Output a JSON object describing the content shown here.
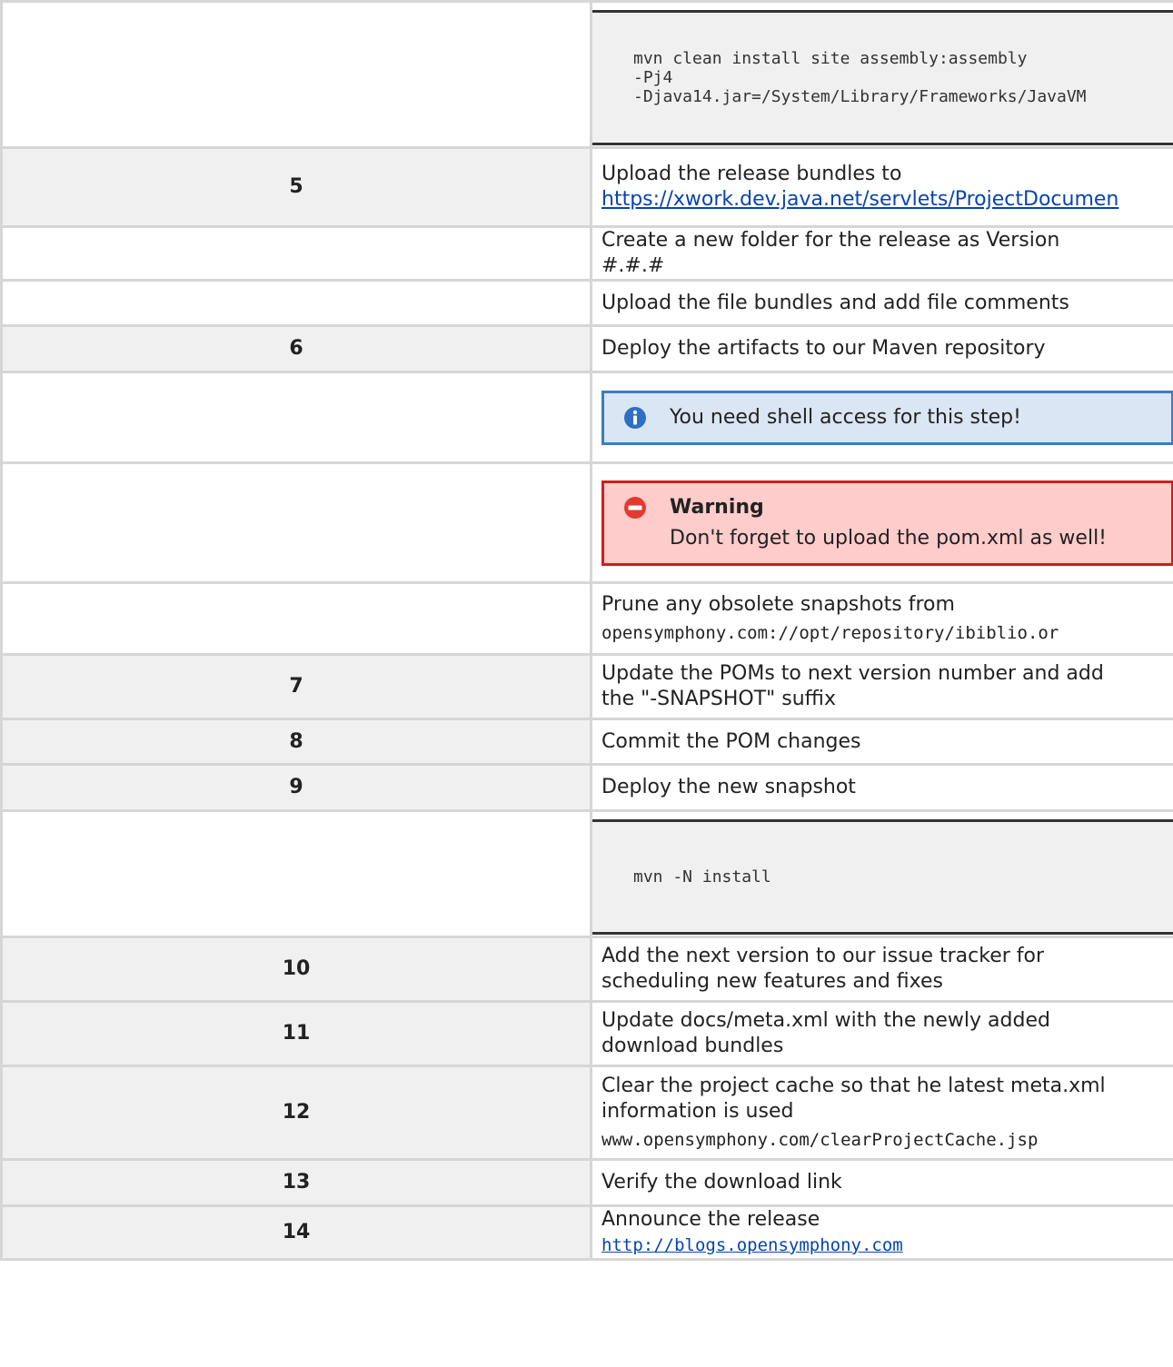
{
  "rows": [
    {
      "step": "",
      "type": "code",
      "code": [
        "mvn clean install site assembly:assembly",
        "-Pj4",
        "-Djava14.jar=/System/Library/Frameworks/JavaVM"
      ]
    },
    {
      "step": "5",
      "type": "text_link",
      "text": "Upload the release bundles to",
      "link": "https://xwork.dev.java.net/servlets/ProjectDocumen"
    },
    {
      "step": "",
      "type": "text",
      "lines": [
        "Create a new folder for the release as Version",
        "#.#.#"
      ]
    },
    {
      "step": "",
      "type": "text",
      "lines": [
        "Upload the file bundles and add file comments"
      ]
    },
    {
      "step": "6",
      "type": "text",
      "lines": [
        "Deploy the artifacts to our Maven repository"
      ]
    },
    {
      "step": "",
      "type": "info",
      "text": "You need shell access for this step!"
    },
    {
      "step": "",
      "type": "warning",
      "title": "Warning",
      "text": "Don't forget to upload the pom.xml as well!"
    },
    {
      "step": "",
      "type": "text_mono",
      "text": "Prune any obsolete snapshots from",
      "mono": "opensymphony.com://opt/repository/ibiblio.or"
    },
    {
      "step": "7",
      "type": "text",
      "lines": [
        "Update the POMs to next version number and add",
        "the \"-SNAPSHOT\" suffix"
      ]
    },
    {
      "step": "8",
      "type": "text",
      "lines": [
        "Commit the POM changes"
      ]
    },
    {
      "step": "9",
      "type": "text",
      "lines": [
        "Deploy the new snapshot"
      ]
    },
    {
      "step": "",
      "type": "code",
      "code": [
        "mvn -N install"
      ]
    },
    {
      "step": "10",
      "type": "text",
      "lines": [
        "Add the next version to our issue tracker for",
        "scheduling new features and fixes"
      ]
    },
    {
      "step": "11",
      "type": "text",
      "lines": [
        "Update docs/meta.xml with the newly added",
        "download bundles"
      ]
    },
    {
      "step": "12",
      "type": "text_mono",
      "text": "Clear the project cache so that he latest meta.xml\ninformation is used",
      "mono": "www.opensymphony.com/clearProjectCache.jsp"
    },
    {
      "step": "13",
      "type": "text",
      "lines": [
        "Verify the download link"
      ]
    },
    {
      "step": "14",
      "type": "text_monolink",
      "text": "Announce the release",
      "link": "http://blogs.opensymphony.com"
    }
  ],
  "colors": {
    "info_bg": "#dae6f3",
    "info_border": "#3e7cc0",
    "warning_bg": "#ffcccc",
    "warning_border": "#cc1f1f",
    "link": "#0645ad"
  },
  "icons": {
    "info": "info-circle-icon",
    "warning": "no-entry-icon"
  }
}
